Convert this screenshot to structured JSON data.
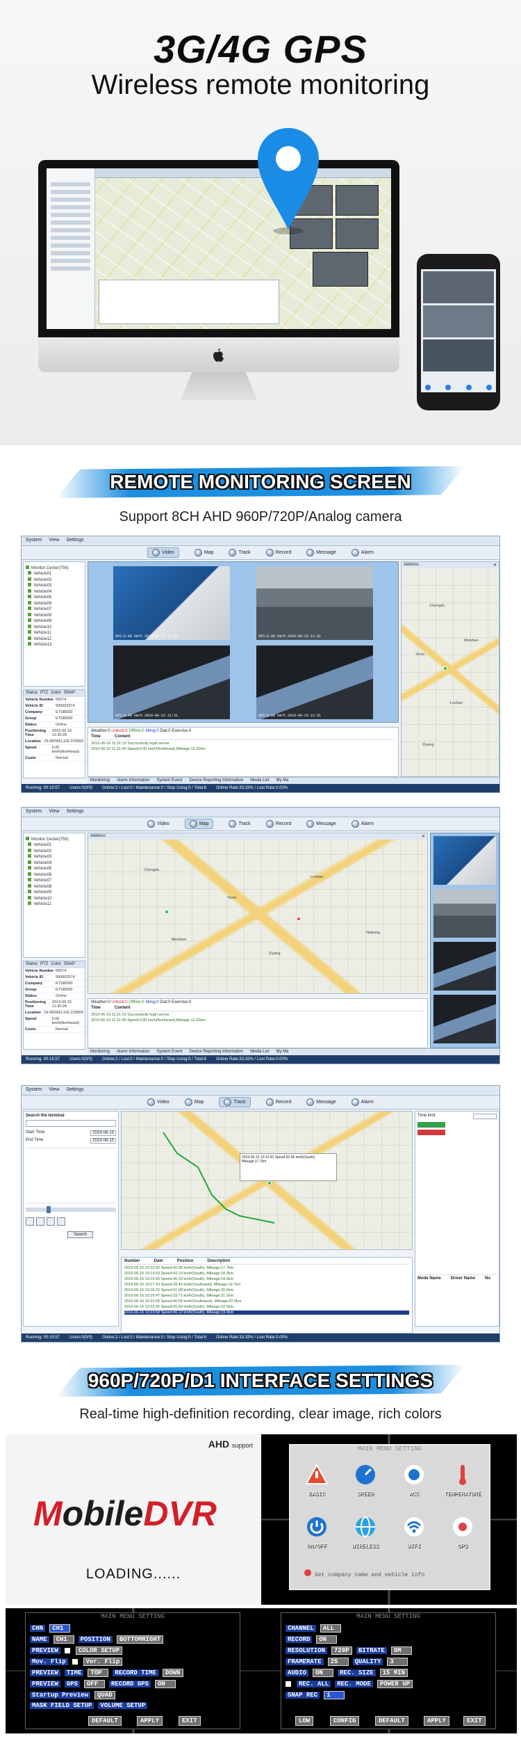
{
  "hero": {
    "title": "3G/4G GPS",
    "subtitle": "Wireless remote monitoring"
  },
  "sections": {
    "monitoring_title": "REMOTE MONITORING SCREEN",
    "monitoring_caption": "Support 8CH AHD 960P/720P/Analog camera",
    "interface_title": "960P/720P/D1 INTERFACE SETTINGS",
    "interface_caption": "Real-time high-definition recording, clear image, rich colors"
  },
  "app": {
    "menu": [
      "System",
      "View",
      "Settings"
    ],
    "toolbar": [
      "Video",
      "Map",
      "Track",
      "Record",
      "Message",
      "Alarm"
    ],
    "tree_root": "Monitor Center(756)",
    "tree_items": [
      "Vehicle01",
      "Vehicle02",
      "Vehicle03",
      "Vehicle04",
      "Vehicle05",
      "Vehicle06",
      "Vehicle07",
      "Vehicle08",
      "Vehicle09",
      "Vehicle10",
      "Vehicle11",
      "Vehicle12",
      "Vehicle13"
    ],
    "props_tabs": [
      "Status",
      "PTZ",
      "Color",
      "SNAP"
    ],
    "props": [
      {
        "k": "Vehicle Number",
        "v": "00574"
      },
      {
        "k": "Vehicle ID",
        "v": "990002574"
      },
      {
        "k": "Company",
        "v": "ETSBD00"
      },
      {
        "k": "Group",
        "v": "ETSBD00"
      },
      {
        "k": "Status",
        "v": "Online"
      },
      {
        "k": "Positioning Time",
        "v": "2019-06-15 11:30:28"
      },
      {
        "k": "Location",
        "v": "29.082993,102.233659"
      },
      {
        "k": "Speed",
        "v": "0.00 km/h(Northeast)"
      },
      {
        "k": "Custo",
        "v": "Normal"
      }
    ],
    "bottom_tabs": [
      "Monitoring",
      "Alarm Information",
      "System Event",
      "Device Reporting Information",
      "Media List",
      "My Ma"
    ],
    "status_bar": [
      "Running: 00:15:57",
      "Users:0(0/0)",
      "Online:2 / Lost:0 / Maintenance:0 / Stop Using:0 / Total:6",
      "Online Rate:33.33% / Lost Rate:0.00%"
    ],
    "log_head": [
      "Time",
      "Content"
    ],
    "log_rows": [
      "2019-06-15 11:31:19   Successfully login server",
      "2019-06-15 11:31:40   Speed:0.00 km/h(Northeast),Mileage:12.32km"
    ],
    "notice": {
      "label": "Weather:0",
      "red": "Unlock:0",
      "green": "Offline:0",
      "blue": "Idling:0",
      "tail": "Dial:0 Exercise:0"
    },
    "map_title": "Address",
    "map_places": [
      "Chengdu",
      "Ya'an",
      "Leshan",
      "Meishan",
      "Ziyang",
      "Neijiang"
    ]
  },
  "track": {
    "search_label": "Search the terminal",
    "fields": [
      {
        "k": "Start Time",
        "v": "2019-06-15"
      },
      {
        "k": "End Time",
        "v": "2019-06-15"
      }
    ],
    "buttons": [
      "Search"
    ],
    "list_head": [
      "Number",
      "Date",
      "Position",
      "Description"
    ],
    "rows": [
      "2019-06-15 10:12:42   Speed:30.96 km/h(South), Mileage:17.7km",
      "2019-06-15 10:14:03   Speed:42.10 km/h(South), Mileage:18.3km",
      "2019-06-15 10:15:55   Speed:36.20 km/h(South), Mileage:19.0km",
      "2019-06-15 10:17:10   Speed:28.44 km/h(Southeast), Mileage:19.7km",
      "2019-06-15 10:18:22   Speed:51.08 km/h(South), Mileage:20.6km",
      "2019-06-15 10:19:47   Speed:33.71 km/h(South), Mileage:21.2km",
      "2019-06-15 10:21:05   Speed:40.55 km/h(Southwest), Mileage:22.0km",
      "2019-06-15 10:22:36   Speed:25.90 km/h(South), Mileage:22.5km",
      "2019-06-15 10:23:58   Speed:46.12 km/h(South), Mileage:23.4km"
    ],
    "info_head": [
      "Mode Name",
      "Driver Name",
      "No"
    ],
    "time_field": "Time limit"
  },
  "dvr": {
    "ahd": "AHD",
    "ahd_support": "support",
    "logo_m": "M",
    "logo_rest": "obile",
    "logo_dvr": "DVR",
    "loading": "LOADING......",
    "menu_title": "MAIN MENU SETTING",
    "icons": [
      "BASIC",
      "SPEED",
      "ACC",
      "TEMPERATURE",
      "ON/OFF",
      "WIRELESS",
      "WIFI",
      "GPS"
    ],
    "notice": "Set company name and vehicle info",
    "preview": {
      "rows": [
        {
          "lbl": "CHN",
          "vals": [
            "CH1"
          ]
        },
        {
          "lbl": "NAME",
          "vals": [
            "CH1",
            "POSITION",
            "BOTTOMRIGHT"
          ]
        },
        {
          "lbl": "PREVIEW",
          "vals": [
            "COLOR SETUP"
          ]
        },
        {
          "lbl": "Mov. Flip",
          "vals": [
            "Ver. Flip"
          ]
        },
        {
          "lbl": "PREVIEW",
          "vals": [
            "TIME",
            "TOP",
            "RECORD TIME",
            "DOWN"
          ]
        },
        {
          "lbl": "PREVIEW",
          "vals": [
            "GPS",
            "OFF",
            "RECORD GPS",
            "ON"
          ]
        },
        {
          "lbl": "Startup Preview",
          "vals": [
            "QUAD"
          ]
        },
        {
          "lbl": "MASK FIELD SETUP",
          "vals": [
            "VOLUME SETUP"
          ]
        }
      ],
      "buttons": [
        "DEFAULT",
        "APPLY",
        "EXIT"
      ]
    },
    "record": {
      "rows": [
        {
          "lbl": "CHANNEL",
          "vals": [
            "ALL"
          ]
        },
        {
          "lbl": "RECORD",
          "vals": [
            "ON"
          ]
        },
        {
          "lbl": "RESOLUTION",
          "vals": [
            "720P",
            "BITRATE",
            "8M"
          ]
        },
        {
          "lbl": "FRAMERATE",
          "vals": [
            "25",
            "QUALITY",
            "3"
          ]
        },
        {
          "lbl": "AUDIO",
          "vals": [
            "ON",
            "REC. SIZE",
            "15 MIN"
          ]
        },
        {
          "lbl": "REC. ALL",
          "vals": [
            "REC. MODE",
            "POWER UP"
          ]
        },
        {
          "lbl": "SNAP REC",
          "vals": [
            "1"
          ]
        }
      ],
      "buttons": [
        "LOW",
        "CONFIG",
        "DEFAULT",
        "APPLY",
        "EXIT"
      ]
    }
  }
}
